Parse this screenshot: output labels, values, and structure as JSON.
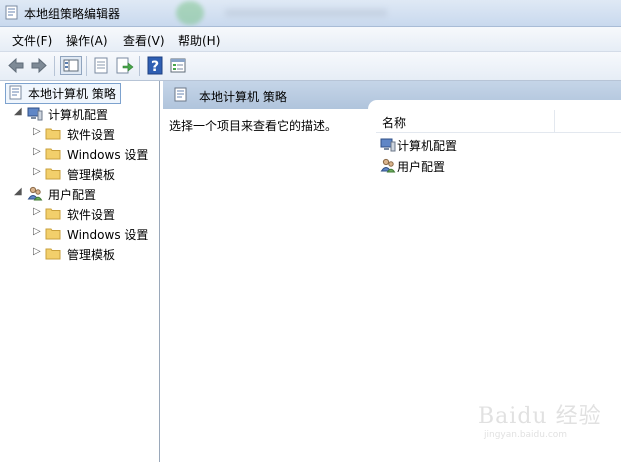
{
  "window": {
    "title": "本地组策略编辑器"
  },
  "menu": {
    "items": [
      "文件(F)",
      "操作(A)",
      "查看(V)",
      "帮助(H)"
    ]
  },
  "toolbar": {
    "buttons": [
      "back-icon",
      "forward-icon",
      "show-tree-icon",
      "properties-icon",
      "export-list-icon",
      "help-icon",
      "filter-view-icon"
    ]
  },
  "tree": {
    "root": "本地计算机 策略",
    "computer": {
      "label": "计算机配置",
      "children": [
        "软件设置",
        "Windows 设置",
        "管理模板"
      ]
    },
    "user": {
      "label": "用户配置",
      "children": [
        "软件设置",
        "Windows 设置",
        "管理模板"
      ]
    }
  },
  "right": {
    "header": "本地计算机 策略",
    "description": "选择一个项目来查看它的描述。",
    "column_name": "名称",
    "items": [
      "计算机配置",
      "用户配置"
    ]
  },
  "watermark": {
    "brand": "Baidu 经验",
    "url": "jingyan.baidu.com"
  },
  "colors": {
    "header_bg": "#b7c9df",
    "selection_border": "#7da2ce",
    "folder": "#f2cf6b"
  }
}
